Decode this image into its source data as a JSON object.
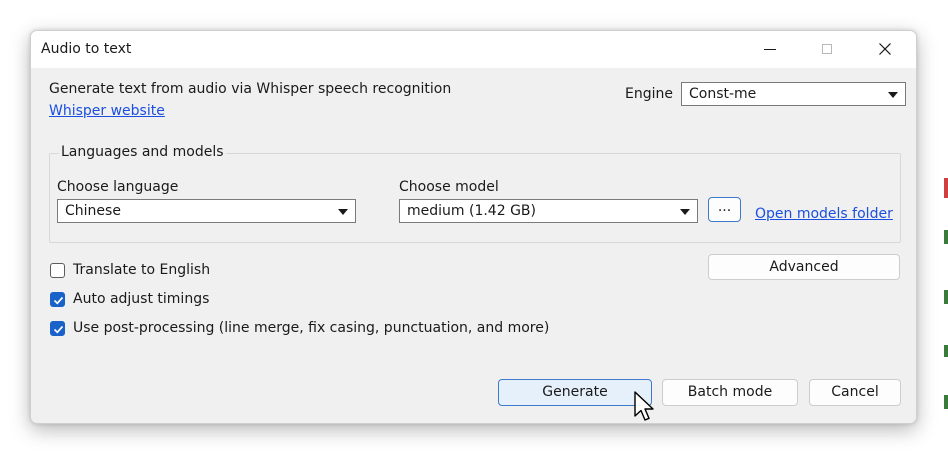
{
  "window": {
    "title": "Audio to text"
  },
  "header": {
    "description": "Generate text from audio via Whisper speech recognition",
    "website_link": "Whisper website",
    "engine_label": "Engine",
    "engine_value": "Const-me"
  },
  "languages_group": {
    "title": "Languages and models",
    "language_label": "Choose language",
    "language_value": "Chinese",
    "model_label": "Choose model",
    "model_value": "medium (1.42 GB)",
    "browse_label": "...",
    "open_folder_link": "Open models folder"
  },
  "options": {
    "translate_label": "Translate to English",
    "translate_checked": false,
    "auto_adjust_label": "Auto adjust timings",
    "auto_adjust_checked": true,
    "post_processing_label": "Use post-processing (line merge, fix casing, punctuation, and more)",
    "post_processing_checked": true,
    "advanced_label": "Advanced"
  },
  "footer": {
    "generate_label": "Generate",
    "batch_label": "Batch mode",
    "cancel_label": "Cancel"
  },
  "colors": {
    "accent": "#1862c9",
    "link": "#1a4fe0",
    "dialog_bg": "#f0f0f0"
  }
}
